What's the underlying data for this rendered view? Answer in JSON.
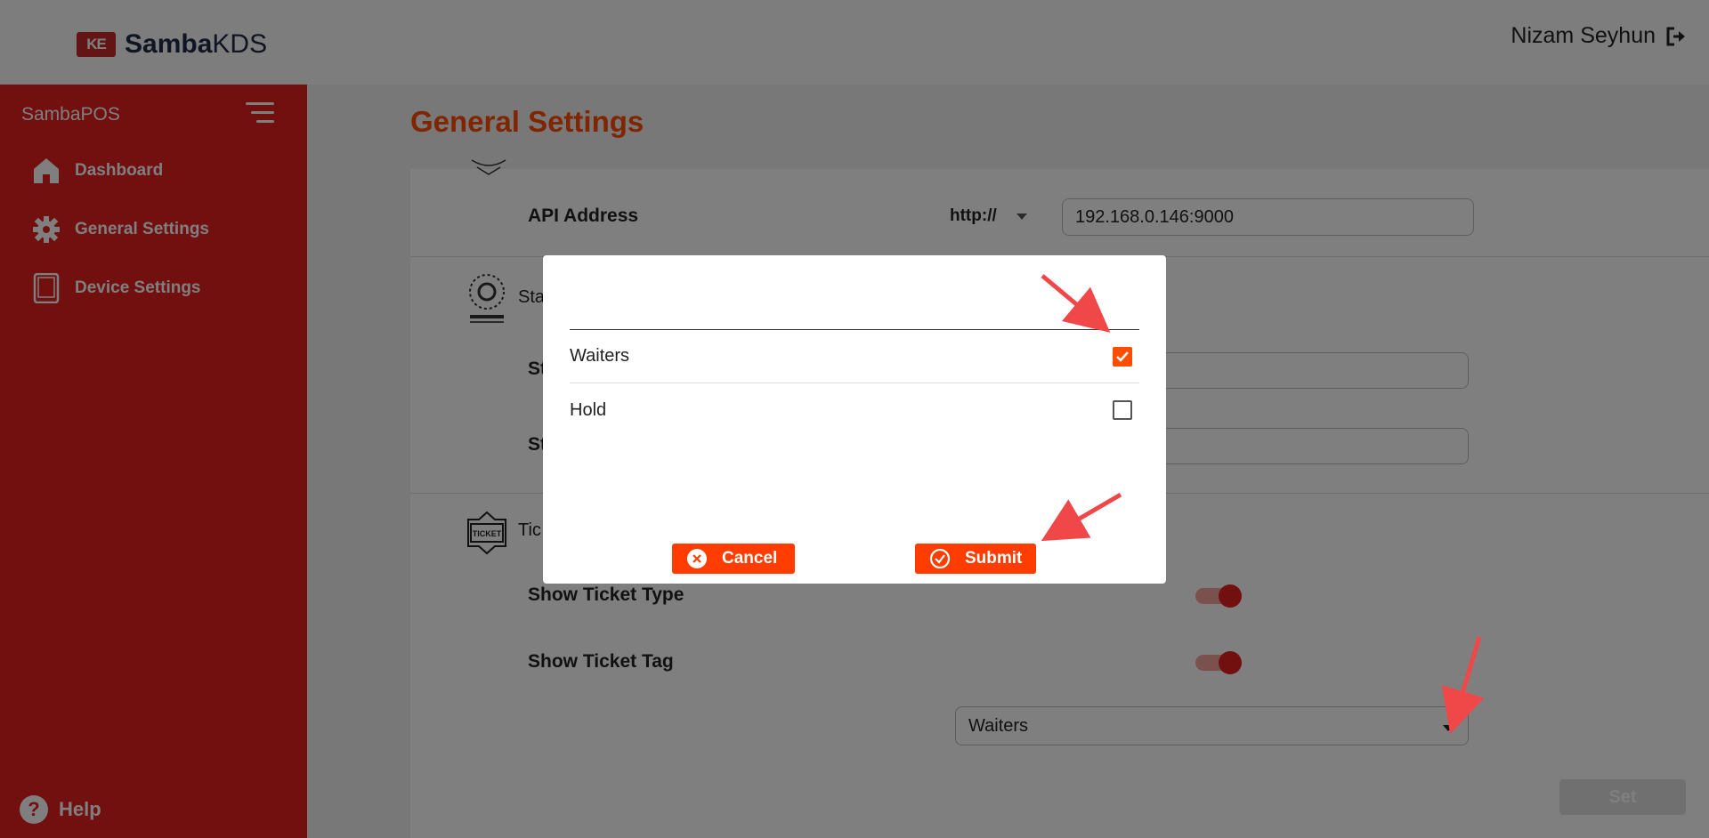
{
  "header": {
    "logo_badge": "KE",
    "logo_bold": "Samba",
    "logo_light": "KDS",
    "user_name": "Nizam Seyhun"
  },
  "sidebar": {
    "title": "SambaPOS",
    "items": [
      {
        "label": "Dashboard",
        "icon": "home-icon"
      },
      {
        "label": "General Settings",
        "icon": "gear-icon"
      },
      {
        "label": "Device Settings",
        "icon": "tablet-icon"
      }
    ],
    "help_label": "Help",
    "help_symbol": "?"
  },
  "main": {
    "title": "General Settings",
    "api_label": "API Address",
    "protocol": "http://",
    "api_value": "192.168.0.146:9000",
    "section2_label": "Sta",
    "row2_label": "St",
    "row3_label": "St",
    "section3_label": "Tic",
    "ticket_icon_text": "TICKET",
    "show_ticket_type": "Show Ticket Type",
    "show_ticket_tag": "Show Ticket Tag",
    "ticket_tag_select": "Waiters",
    "set_button": "Set"
  },
  "modal": {
    "search_value": "",
    "options": [
      {
        "label": "Waiters",
        "checked": true
      },
      {
        "label": "Hold",
        "checked": false
      }
    ],
    "cancel_label": "Cancel",
    "submit_label": "Submit"
  },
  "colors": {
    "brand_red": "#e3211f",
    "accent_orange": "#ff4d00",
    "annotation_arrow": "#f04848"
  }
}
